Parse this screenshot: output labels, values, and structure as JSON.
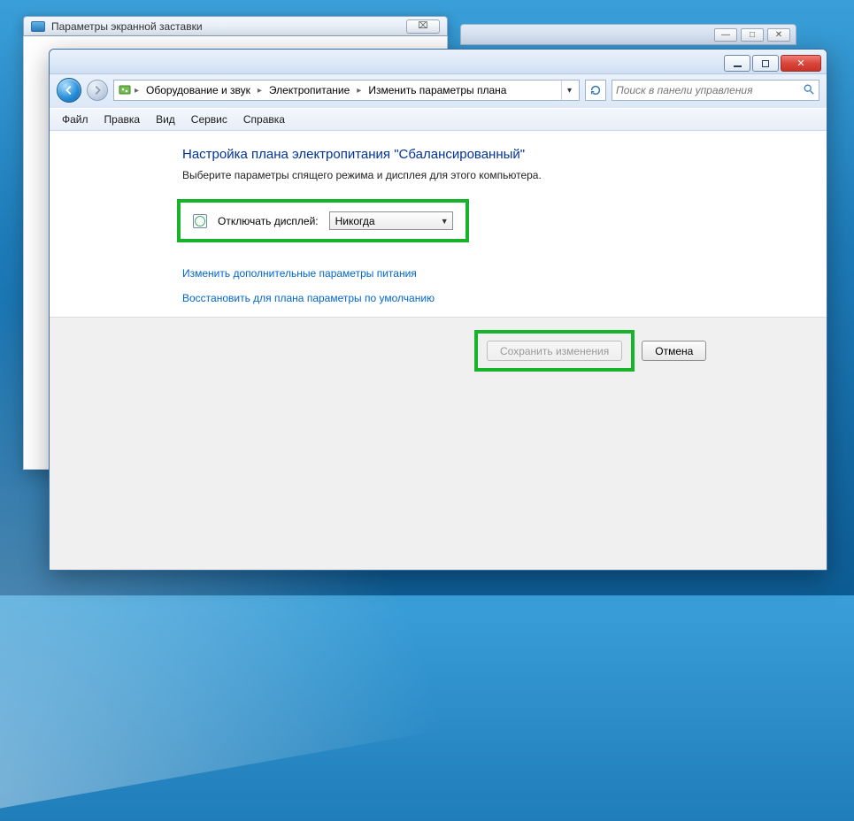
{
  "bg_window": {
    "title": "Параметры экранной заставки",
    "close_glyph": "⌧"
  },
  "bg_top_right": {
    "minimize": "—",
    "maximize": "□",
    "close": "✕"
  },
  "window": {
    "minimize": "—",
    "maximize": "□",
    "close": "✕"
  },
  "nav": {
    "back": "◀",
    "fwd": "▶",
    "refresh": "↻",
    "dd": "▾"
  },
  "breadcrumbs": {
    "item0": "Оборудование и звук",
    "item1": "Электропитание",
    "item2": "Изменить параметры плана",
    "sep": "▸"
  },
  "search": {
    "placeholder": "Поиск в панели управления",
    "icon": "🔍"
  },
  "menu": {
    "file": "Файл",
    "edit": "Правка",
    "view": "Вид",
    "service": "Сервис",
    "help": "Справка"
  },
  "page": {
    "heading": "Настройка плана электропитания \"Сбалансированный\"",
    "subtext": "Выберите параметры спящего режима и дисплея для этого компьютера.",
    "display_off_label": "Отключать дисплей:",
    "display_off_value": "Никогда",
    "link_advanced": "Изменить дополнительные параметры питания",
    "link_restore": "Восстановить для плана параметры по умолчанию",
    "btn_save": "Сохранить изменения",
    "btn_cancel": "Отмена"
  }
}
